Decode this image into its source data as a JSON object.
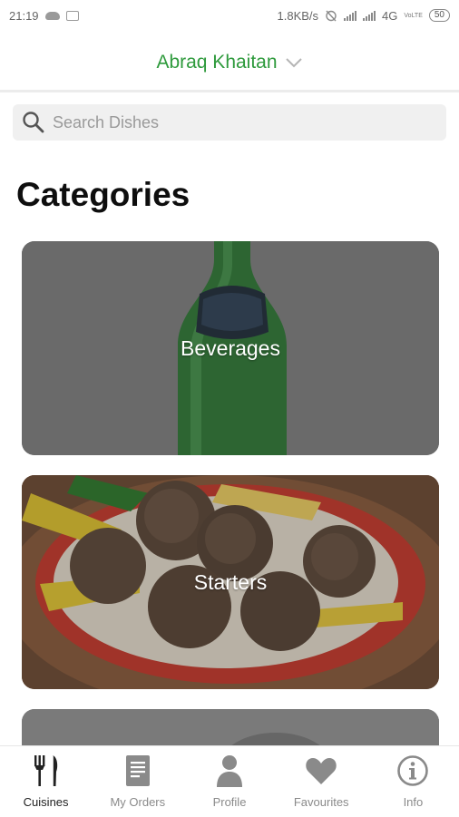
{
  "status_bar": {
    "time": "21:19",
    "speed": "1.8KB/s",
    "network": "4G",
    "volte": "VoLTE",
    "battery": "50"
  },
  "header": {
    "restaurant_name": "Abraq Khaitan"
  },
  "search": {
    "placeholder": "Search Dishes",
    "value": ""
  },
  "section_title": "Categories",
  "categories": [
    {
      "label": "Beverages"
    },
    {
      "label": "Starters"
    },
    {
      "label": ""
    }
  ],
  "bottom_nav": [
    {
      "label": "Cuisines",
      "icon": "cutlery-icon",
      "active": true
    },
    {
      "label": "My Orders",
      "icon": "receipt-icon",
      "active": false
    },
    {
      "label": "Profile",
      "icon": "person-icon",
      "active": false
    },
    {
      "label": "Favourites",
      "icon": "heart-icon",
      "active": false
    },
    {
      "label": "Info",
      "icon": "info-icon",
      "active": false
    }
  ],
  "colors": {
    "accent": "#2e9a3c",
    "nav_inactive": "#8a8a8a",
    "search_bg": "#f0f0f0"
  }
}
